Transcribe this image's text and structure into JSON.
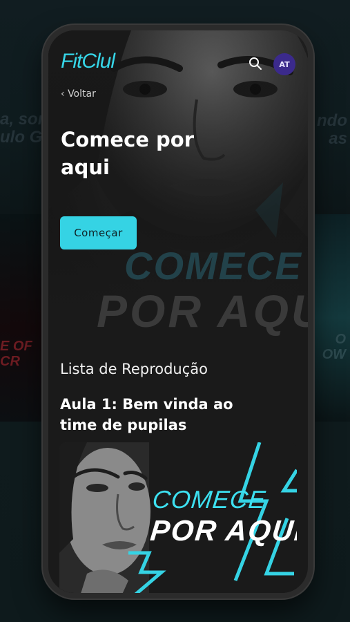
{
  "app": {
    "logo_text": "FitClul",
    "accent_color": "#35d3e4",
    "avatar_initials": "AT",
    "avatar_color": "#3b2a8c"
  },
  "header": {
    "search_icon": "search-icon",
    "back_label": "Voltar",
    "back_icon": "chevron-left-icon"
  },
  "hero": {
    "title": "Comece por aqui",
    "start_button_label": "Começar",
    "art_line_1": "COMECE",
    "art_line_2": "POR AQUI"
  },
  "playlist": {
    "heading": "Lista de Reprodução",
    "lessons": [
      {
        "title": "Aula 1: Bem vinda ao time de pupilas",
        "thumb_line_1": "COMECE",
        "thumb_line_2": "POR AQUI"
      }
    ]
  },
  "background": {
    "left_text": "a, son\nulo Go",
    "right_text": "ndo\nas",
    "promo_left": "E OF\nCR",
    "promo_right": "O\nOW"
  }
}
